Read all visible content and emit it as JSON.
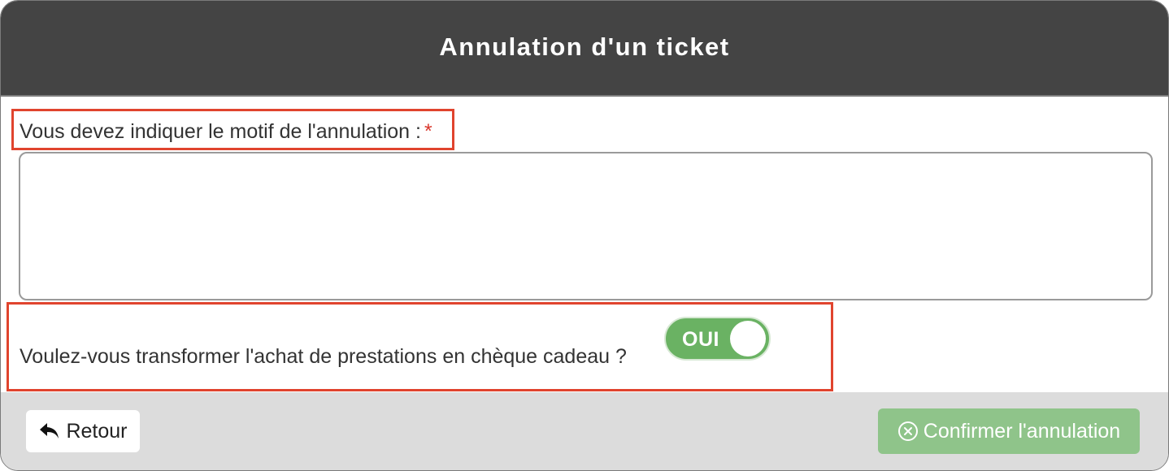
{
  "dialog": {
    "title": "Annulation d'un ticket"
  },
  "motif": {
    "label": "Vous devez indiquer le motif de l'annulation :",
    "required_marker": "*",
    "value": "",
    "placeholder": ""
  },
  "cheque": {
    "question": "Voulez-vous transformer l'achat de prestations en chèque cadeau ?",
    "toggle_label": "OUI",
    "toggle_state": "on"
  },
  "footer": {
    "back_label": "Retour",
    "back_icon": "reply-arrow-icon",
    "confirm_label": "Confirmer l'annulation",
    "confirm_icon": "circle-x-icon"
  },
  "colors": {
    "header_bg": "#444444",
    "highlight_border": "#e0442e",
    "toggle_on": "#6ab263",
    "confirm_bg": "#8fc48a",
    "footer_bg": "#dcdcdc",
    "required": "#d9362b"
  }
}
